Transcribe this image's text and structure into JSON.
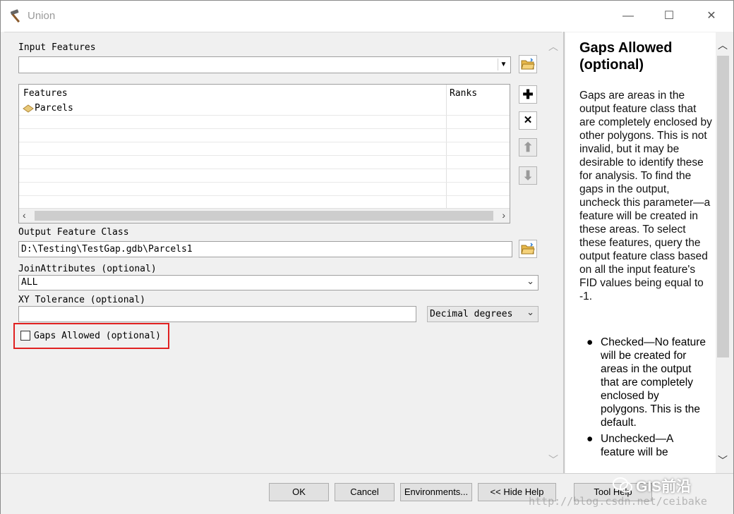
{
  "window": {
    "title": "Union",
    "minimize": "—",
    "maximize": "☐",
    "close": "✕"
  },
  "form": {
    "input_features_label": "Input Features",
    "input_features_value": "",
    "grid": {
      "columns": [
        "Features",
        "Ranks"
      ],
      "rows": [
        {
          "feature": "Parcels",
          "rank": ""
        }
      ]
    },
    "output_label": "Output Feature Class",
    "output_value": "D:\\Testing\\TestGap.gdb\\Parcels1",
    "join_label": "JoinAttributes (optional)",
    "join_value": "ALL",
    "xy_label": "XY Tolerance (optional)",
    "xy_value": "",
    "xy_unit": "Decimal degrees",
    "gaps_label": "Gaps Allowed (optional)",
    "gaps_checked": false
  },
  "help": {
    "title": "Gaps Allowed (optional)",
    "body": "Gaps are areas in the output feature class that are completely enclosed by other polygons. This is not invalid, but it may be desirable to identify these for analysis. To find the gaps in the output, uncheck this parameter—a feature will be created in these areas. To select these features, query the output feature class based on all the input feature's FID values being equal to -1.",
    "items": [
      "Checked—No feature will be created for areas in the output that are completely enclosed by polygons. This is the default.",
      "Unchecked—A feature will be"
    ]
  },
  "buttons": {
    "ok": "OK",
    "cancel": "Cancel",
    "environments": "Environments...",
    "hide_help": "<< Hide Help",
    "tool_help": "Tool Help"
  },
  "watermark": {
    "url": "http://blog.csdn.net/ceibake",
    "brand": "GIS前沿"
  },
  "icons": {
    "title": "hammer-icon",
    "folder": "open-folder-icon",
    "add": "plus-icon",
    "remove": "x-icon",
    "up": "arrow-up-icon",
    "down": "arrow-down-icon",
    "feature": "polygon-layer-icon"
  }
}
